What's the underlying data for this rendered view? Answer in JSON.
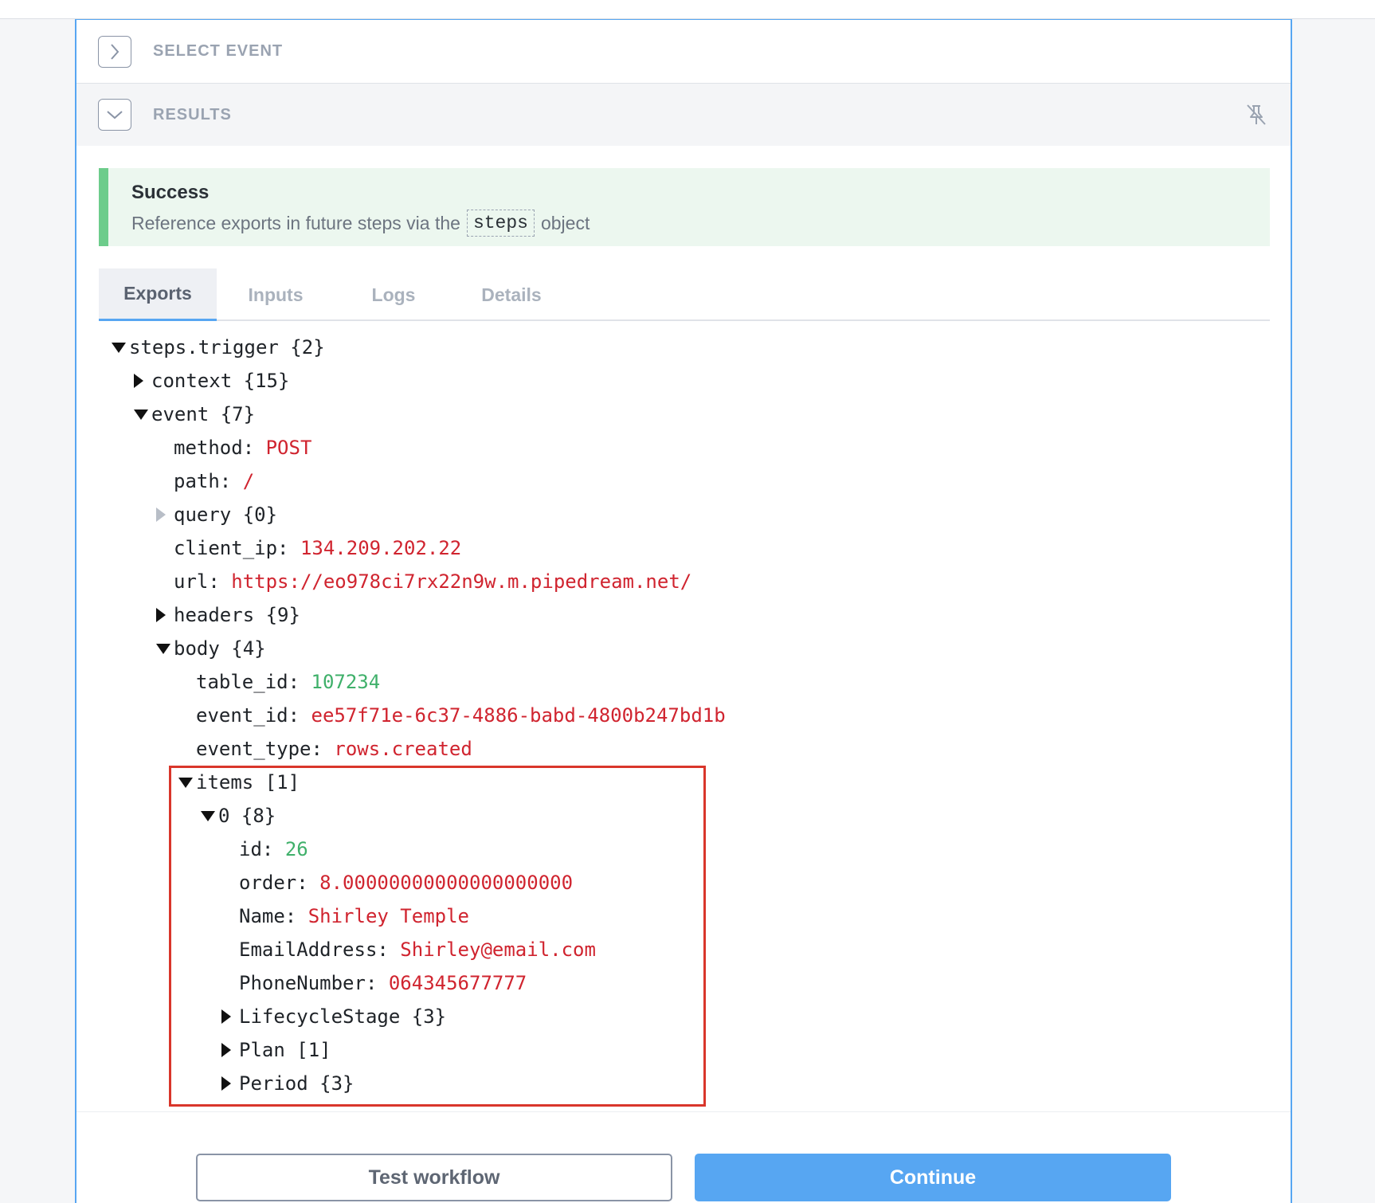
{
  "sections": {
    "select_event": {
      "title": "SELECT EVENT"
    },
    "results": {
      "title": "RESULTS"
    }
  },
  "success": {
    "title": "Success",
    "message_before": "Reference exports in future steps via the",
    "code": "steps",
    "message_after": "object"
  },
  "tabs": [
    {
      "label": "Exports",
      "active": true
    },
    {
      "label": "Inputs",
      "active": false
    },
    {
      "label": "Logs",
      "active": false
    },
    {
      "label": "Details",
      "active": false
    }
  ],
  "tree": [
    {
      "label": "steps.trigger {2}",
      "caret": "down"
    },
    {
      "label": "context {15}",
      "caret": "right"
    },
    {
      "label": "event {7}",
      "caret": "down"
    },
    {
      "key": "method:",
      "value": "POST",
      "type": "string"
    },
    {
      "key": "path:",
      "value": "/",
      "type": "string"
    },
    {
      "label": "query {0}",
      "caret": "right-faint"
    },
    {
      "key": "client_ip:",
      "value": "134.209.202.22",
      "type": "string"
    },
    {
      "key": "url:",
      "value": "https://eo978ci7rx22n9w.m.pipedream.net/",
      "type": "string"
    },
    {
      "label": "headers {9}",
      "caret": "right"
    },
    {
      "label": "body {4}",
      "caret": "down"
    },
    {
      "key": "table_id:",
      "value": "107234",
      "type": "number"
    },
    {
      "key": "event_id:",
      "value": "ee57f71e-6c37-4886-babd-4800b247bd1b",
      "type": "string"
    },
    {
      "key": "event_type:",
      "value": "rows.created",
      "type": "string"
    },
    {
      "label": "items [1]",
      "caret": "down"
    },
    {
      "label": "0 {8}",
      "caret": "down"
    },
    {
      "key": "id:",
      "value": "26",
      "type": "number"
    },
    {
      "key": "order:",
      "value": "8.00000000000000000000",
      "type": "string"
    },
    {
      "key": "Name:",
      "value": "Shirley Temple",
      "type": "string"
    },
    {
      "key": "EmailAddress:",
      "value": "Shirley@email.com",
      "type": "string"
    },
    {
      "key": "PhoneNumber:",
      "value": "064345677777",
      "type": "string"
    },
    {
      "label": "LifecycleStage {3}",
      "caret": "right"
    },
    {
      "label": "Plan [1]",
      "caret": "right"
    },
    {
      "label": "Period {3}",
      "caret": "right"
    }
  ],
  "buttons": {
    "test": "Test workflow",
    "continue": "Continue"
  },
  "icons": {
    "select_event_toggle": "chevron-right-icon",
    "results_toggle": "chevron-down-icon",
    "pin": "unpin-icon"
  },
  "colors": {
    "accent": "#57a6f2",
    "success": "#6dcc8b",
    "string_value": "#d0242f",
    "number_value": "#3fb06a",
    "highlight_box": "#d9362b"
  }
}
